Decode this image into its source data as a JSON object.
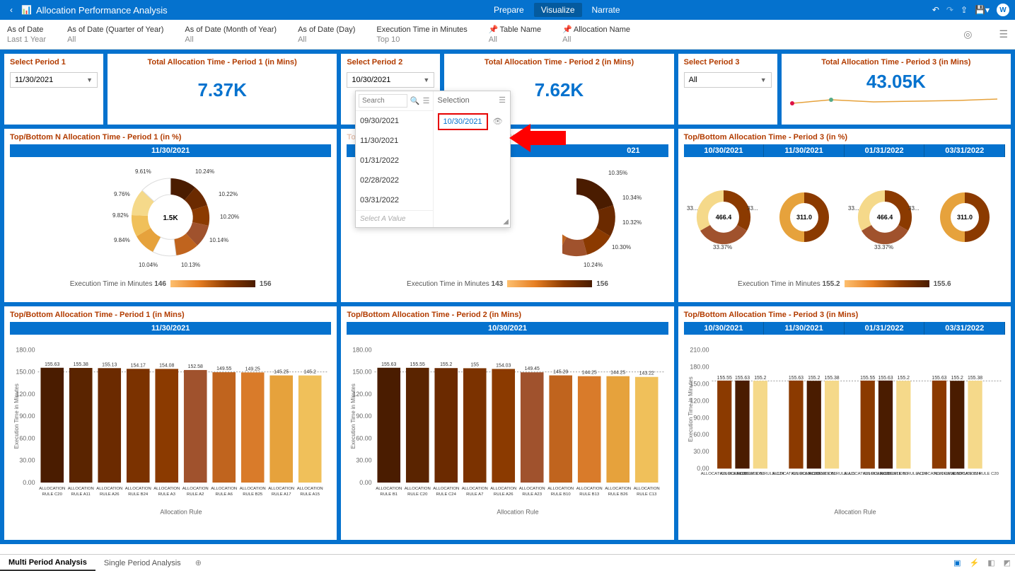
{
  "header": {
    "title": "Allocation Performance Analysis",
    "tabs": [
      "Prepare",
      "Visualize",
      "Narrate"
    ],
    "active_tab": "Visualize",
    "avatar_letter": "W"
  },
  "filters": [
    {
      "name": "As of Date",
      "value": "Last 1 Year"
    },
    {
      "name": "As of Date (Quarter of Year)",
      "value": "All"
    },
    {
      "name": "As of Date (Month of Year)",
      "value": "All"
    },
    {
      "name": "As of Date (Day)",
      "value": "All"
    },
    {
      "name": "Execution Time in Minutes",
      "value": "Top 10"
    },
    {
      "name": "Table Name",
      "value": "All",
      "pinned": true
    },
    {
      "name": "Allocation Name",
      "value": "All",
      "pinned": true
    }
  ],
  "periods": {
    "p1": {
      "label": "Select Period 1",
      "selected": "11/30/2021",
      "kpi_title": "Total Allocation Time - Period 1 (in Mins)",
      "kpi_value": "7.37K"
    },
    "p2": {
      "label": "Select Period 2",
      "selected": "10/30/2021",
      "kpi_title": "Total Allocation Time - Period 2 (in Mins)",
      "kpi_value": "7.62K"
    },
    "p3": {
      "label": "Select Period 3",
      "selected": "All",
      "kpi_title": "Total Allocation Time - Period 3 (in Mins)",
      "kpi_value": "43.05K"
    }
  },
  "dropdown_panel": {
    "search_placeholder": "Search",
    "options": [
      "09/30/2021",
      "11/30/2021",
      "01/31/2022",
      "02/28/2022",
      "03/31/2022"
    ],
    "hint": "Select A Value",
    "selection_header": "Selection",
    "selected": "10/30/2021"
  },
  "donut_titles": {
    "p1": "Top/Bottom N Allocation Time - Period 1 (in %)",
    "p2": "Top/Bottom N Allocation Time - Period 2 (in %)",
    "p3": "Top/Bottom Allocation Time - Period 3 (in %)"
  },
  "donut_heads": {
    "p1": "11/30/2021",
    "p2": "10/30/2021",
    "p3": [
      "10/30/2021",
      "11/30/2021",
      "01/31/2022",
      "03/31/2022"
    ]
  },
  "legend": {
    "label": "Execution Time in Minutes",
    "p1_min": "146",
    "p1_max": "156",
    "p2_min": "143",
    "p2_max": "156",
    "p3_min": "155.2",
    "p3_max": "155.6"
  },
  "bar_titles": {
    "p1": "Top/Bottom Allocation Time - Period 1 (in Mins)",
    "p2": "Top/Bottom Allocation Time - Period 2 (in Mins)",
    "p3": "Top/Bottom Allocation Time - Period 3 (in Mins)"
  },
  "bar_heads": {
    "p1": "11/30/2021",
    "p2": "10/30/2021",
    "p3": [
      "10/30/2021",
      "11/30/2021",
      "01/31/2022",
      "03/31/2022"
    ]
  },
  "bottom_tabs": {
    "active": "Multi Period Analysis",
    "other": "Single Period Analysis"
  },
  "chart_data": [
    {
      "type": "pie",
      "title": "Top/Bottom N Allocation Time - Period 1 (in %)",
      "center": "1.5K",
      "slices": [
        {
          "label": "10.24%",
          "value": 10.24
        },
        {
          "label": "10.22%",
          "value": 10.22
        },
        {
          "label": "10.20%",
          "value": 10.2
        },
        {
          "label": "10.14%",
          "value": 10.14
        },
        {
          "label": "10.13%",
          "value": 10.13
        },
        {
          "label": "10.04%",
          "value": 10.04
        },
        {
          "label": "9.84%",
          "value": 9.84
        },
        {
          "label": "9.82%",
          "value": 9.82
        },
        {
          "label": "9.76%",
          "value": 9.76
        },
        {
          "label": "9.61%",
          "value": 9.61
        }
      ],
      "legend": {
        "label": "Execution Time in Minutes",
        "min": 146,
        "max": 156
      }
    },
    {
      "type": "pie",
      "title": "Top/Bottom N Allocation Time - Period 2 (in %)",
      "center": "",
      "slices": [
        {
          "label": "10.35%",
          "value": 10.35
        },
        {
          "label": "10.34%",
          "value": 10.34
        },
        {
          "label": "10.32%",
          "value": 10.32
        },
        {
          "label": "10.30%",
          "value": 10.3
        },
        {
          "label": "10.24%",
          "value": 10.24
        }
      ],
      "legend": {
        "label": "Execution Time in Minutes",
        "min": 143,
        "max": 156
      }
    },
    {
      "type": "pie",
      "title": "Top/Bottom Allocation Time - Period 3 (in %)",
      "subcharts": [
        {
          "date": "10/30/2021",
          "center": "466.4",
          "slices": [
            {
              "label": "33...",
              "value": 33.3
            },
            {
              "label": "33...",
              "value": 33.3
            },
            {
              "label": "33.37%",
              "value": 33.37
            }
          ]
        },
        {
          "date": "11/30/2021",
          "center": "311.0",
          "slices": [
            {
              "label": "",
              "value": 50
            },
            {
              "label": "",
              "value": 50
            }
          ]
        },
        {
          "date": "01/31/2022",
          "center": "466.4",
          "slices": [
            {
              "label": "33...",
              "value": 33.3
            },
            {
              "label": "33...",
              "value": 33.3
            },
            {
              "label": "33.37%",
              "value": 33.37
            }
          ]
        },
        {
          "date": "03/31/2022",
          "center": "311.0",
          "slices": [
            {
              "label": "",
              "value": 50
            },
            {
              "label": "",
              "value": 50
            }
          ]
        }
      ],
      "legend": {
        "label": "Execution Time in Minutes",
        "min": 155.2,
        "max": 155.6
      }
    },
    {
      "type": "bar",
      "title": "Top/Bottom Allocation Time - Period 1 (in Mins)",
      "xlabel": "Allocation Rule",
      "ylabel": "Execution Time in Minutes",
      "ylim": [
        0,
        180
      ],
      "categories": [
        "ALLOCATION RULE C20",
        "ALLOCATION RULE A11",
        "ALLOCATION RULE A26",
        "ALLOCATION RULE B24",
        "ALLOCATION RULE A3",
        "ALLOCATION RULE A2",
        "ALLOCATION RULE A6",
        "ALLOCATION RULE B25",
        "ALLOCATION RULE A17",
        "ALLOCATION RULE A15"
      ],
      "values": [
        155.63,
        155.38,
        155.13,
        154.17,
        154.08,
        152.58,
        149.55,
        149.25,
        145.25,
        145.2
      ]
    },
    {
      "type": "bar",
      "title": "Top/Bottom Allocation Time - Period 2 (in Mins)",
      "xlabel": "Allocation Rule",
      "ylabel": "Execution Time in Minutes",
      "ylim": [
        0,
        180
      ],
      "categories": [
        "ALLOCATION RULE B1",
        "ALLOCATION RULE C20",
        "ALLOCATION RULE C24",
        "ALLOCATION RULE A7",
        "ALLOCATION RULE A26",
        "ALLOCATION RULE A23",
        "ALLOCATION RULE B10",
        "ALLOCATION RULE B13",
        "ALLOCATION RULE B26",
        "ALLOCATION RULE C13"
      ],
      "values": [
        155.63,
        155.55,
        155.2,
        155.0,
        154.03,
        149.45,
        145.29,
        144.25,
        144.25,
        143.22
      ]
    },
    {
      "type": "bar",
      "title": "Top/Bottom Allocation Time - Period 3 (in Mins)",
      "xlabel": "Allocation Rule",
      "ylabel": "Execution Time in Minutes",
      "ylim": [
        0,
        210
      ],
      "series": [
        {
          "date": "10/30/2021",
          "categories": [
            "ALLOCATION RULE C20",
            "ALLOCATION RULE B1",
            "ALLOCATION RULE C24"
          ],
          "values": [
            155.55,
            155.63,
            155.2
          ]
        },
        {
          "date": "11/30/2021",
          "categories": [
            "ALLOCATION RULE C20",
            "ALLOCATION RULE B1",
            "ALLOCATION RULE A11"
          ],
          "values": [
            155.63,
            155.2,
            155.38
          ]
        },
        {
          "date": "01/31/2022",
          "categories": [
            "ALLOCATION RULE C20",
            "ALLOCATION RULE B1",
            "ALLOCATION RULE C24"
          ],
          "values": [
            155.55,
            155.63,
            155.2
          ]
        },
        {
          "date": "03/31/2022",
          "categories": [
            "ALLOCATION RULE B1",
            "ALLOCATION RULE C24",
            "ALLOCATION RULE C20"
          ],
          "values": [
            155.63,
            155.2,
            155.38
          ]
        }
      ]
    }
  ]
}
